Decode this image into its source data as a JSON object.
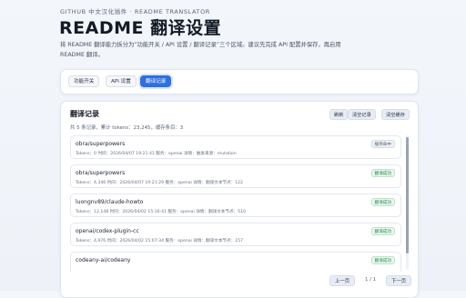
{
  "header": {
    "eyebrow": "GITHUB 中文汉化插件 · README TRANSLATOR",
    "title": "README 翻译设置",
    "description": "将 README 翻译能力拆分为“功能开关 / API 设置 / 翻译记录”三个区域。建议先完成 API 配置并保存，再启用 README 翻译。"
  },
  "tabs": [
    {
      "label": "功能开关",
      "active": false
    },
    {
      "label": "API 设置",
      "active": false
    },
    {
      "label": "翻译记录",
      "active": true
    }
  ],
  "records_panel": {
    "title": "翻译记录",
    "summary": "共 5 条记录，累计 tokens：23,245，缓存条目：3",
    "refresh_label": "刷新",
    "clear_records_label": "清空记录",
    "clear_cache_label": "清空缓存"
  },
  "records": [
    {
      "repo": "obra/superpowers",
      "meta": "Tokens：0   时间：2026/04/07 19:21:41   服务：openai   详情：触发来源：mutation",
      "status": "缓存命中",
      "status_type": "pending"
    },
    {
      "repo": "obra/superpowers",
      "meta": "Tokens：4,346   时间：2026/04/07 19:21:29   服务：openai   详情：翻译文本节点：122",
      "status": "翻译成功",
      "status_type": "ok"
    },
    {
      "repo": "luongnv89/claude-howto",
      "meta": "Tokens：12,148   时间：2026/04/02 15:16:41   服务：openai   详情：翻译文本节点：510",
      "status": "翻译成功",
      "status_type": "ok"
    },
    {
      "repo": "openai/codex-plugin-cc",
      "meta": "Tokens：4,976   时间：2026/04/02 15:07:34   服务：openai   详情：翻译文本节点：157",
      "status": "翻译成功",
      "status_type": "ok"
    },
    {
      "repo": "codeany-ai/codeany",
      "meta": "",
      "status": "翻译成功",
      "status_type": "ok"
    }
  ],
  "pagination": {
    "prev_label": "上一页",
    "page_info": "1 / 1",
    "next_label": "下一页"
  }
}
